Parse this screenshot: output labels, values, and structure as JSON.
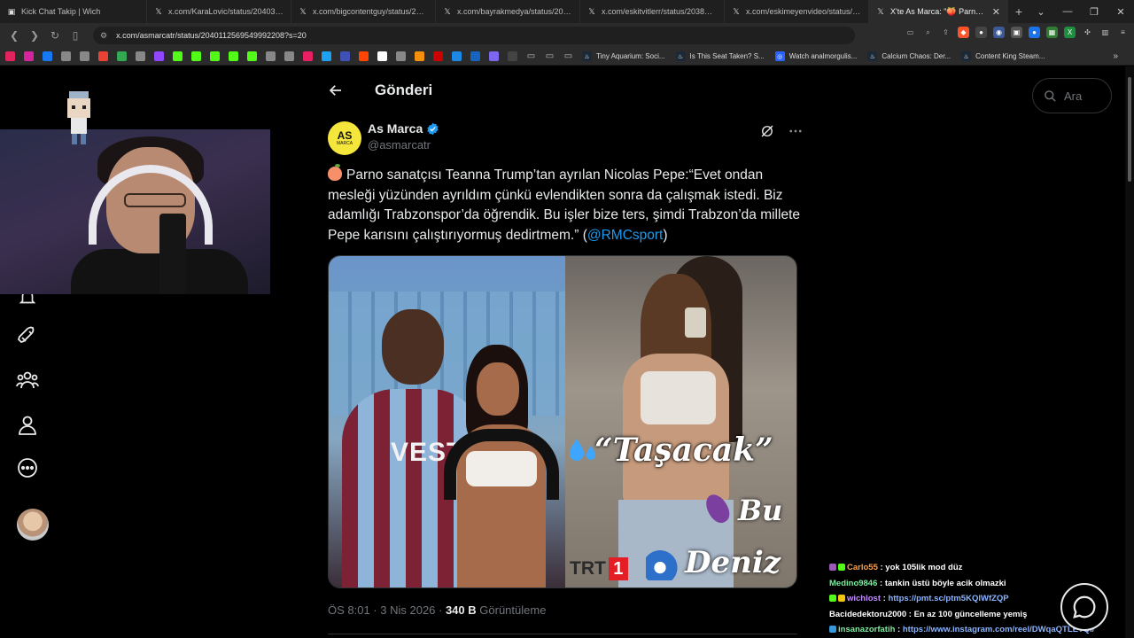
{
  "browser": {
    "tabs": [
      {
        "title": "Kick Chat Takip | Wich",
        "icon": "kick-icon"
      },
      {
        "title": "x.com/KaraLovic/status/20403206143",
        "icon": "x-icon"
      },
      {
        "title": "x.com/bigcontentguy/status/2040180",
        "icon": "x-icon"
      },
      {
        "title": "x.com/bayrakmedya/status/20403480",
        "icon": "x-icon"
      },
      {
        "title": "x.com/eskitvitlerr/status/20389192354",
        "icon": "x-icon"
      },
      {
        "title": "x.com/eskimeyenvideo/status/20404",
        "icon": "x-icon"
      },
      {
        "title": "X'te As Marca: \"🍑 Parno sanatç",
        "icon": "x-icon",
        "active": true
      }
    ],
    "url": "x.com/asmarcatr/status/2040112569549992208?s=20",
    "bookmarks": [
      {
        "label": "Tiny Aquarium: Soci...",
        "icon": "steam-icon"
      },
      {
        "label": "Is This Seat Taken? S...",
        "icon": "steam-icon"
      },
      {
        "label": "Watch analmorgulis...",
        "icon": "globe-icon"
      },
      {
        "label": "Calcium Chaos: Der...",
        "icon": "steam-icon"
      },
      {
        "label": "Content King Steam...",
        "icon": "steam-icon"
      }
    ],
    "bookmark_icon_colors": [
      "#e0245e",
      "#d6249f",
      "#1877f2",
      "#888888",
      "#888888",
      "#ea4335",
      "#34a853",
      "#888888",
      "#9146ff",
      "#53fc18",
      "#53fc18",
      "#53fc18",
      "#53fc18",
      "#53fc18",
      "#888888",
      "#888888",
      "#e91e63",
      "#1da1f2",
      "#3f51b5",
      "#ff4500",
      "#ffffff",
      "#888888",
      "#f4900c",
      "#cc0000",
      "#1e88e5",
      "#1565c0",
      "#7b68ee",
      "#444444"
    ]
  },
  "page": {
    "header_title": "Gönderi",
    "search_placeholder": "Ara"
  },
  "tweet": {
    "author_name": "As Marca",
    "author_handle": "@asmarcatr",
    "avatar_text": "AS",
    "avatar_subtext": "MARCA",
    "text_before_mention": "Parno sanatçısı Teanna Trump’tan ayrılan Nicolas Pepe:“Evet ondan mesleği yüzünden ayrıldım çünkü evlendikten sonra da çalışmak istedi. Biz adamlığı Trabzonspor’da öğrendik. Bu işler bize ters, şimdi Trabzon’da millete Pepe karısını çalıştırıyormuş dedirtmem.” (",
    "mention": "@RMCsport",
    "text_after_mention": ")",
    "time_date": "ÖS 8:01 · 3 Nis 2026 · ",
    "views_count": "340 B",
    "views_label": " Görüntüleme",
    "media": {
      "overlay_quote": "“Taşacak”",
      "overlay_bu": "Bu",
      "overlay_deniz": "Deniz",
      "channel_logo_text": "TRT",
      "channel_logo_number": "1",
      "jersey_text": "VEST"
    }
  },
  "chat": [
    {
      "user": "Carlo55",
      "msg": " : yok 105lik mod düz",
      "user_color": "#ff9f43",
      "badges": [
        "#9b59b6",
        "#53fc18"
      ]
    },
    {
      "user": "Medino9846",
      "msg": " : tankin üstü böyle acik olmazki",
      "user_color": "#7bed9f",
      "badges": []
    },
    {
      "user": "wichlost",
      "msg": " : ",
      "link": "https://pmt.sc/ptm5KQlWfZQP",
      "user_color": "#c38bff",
      "badges": [
        "#53fc18",
        "#f1c40f"
      ]
    },
    {
      "user": "Bacidedektoru2000",
      "msg": " : En az 100 güncelleme yemiş",
      "user_color": "#ffffff",
      "badges": []
    },
    {
      "user": "insanazorfatih",
      "msg": " : ",
      "link": "https://www.instagram.com/reel/DWqaQTLETQI/",
      "user_color": "#7bed9f",
      "badges": [
        "#3498db"
      ]
    }
  ]
}
